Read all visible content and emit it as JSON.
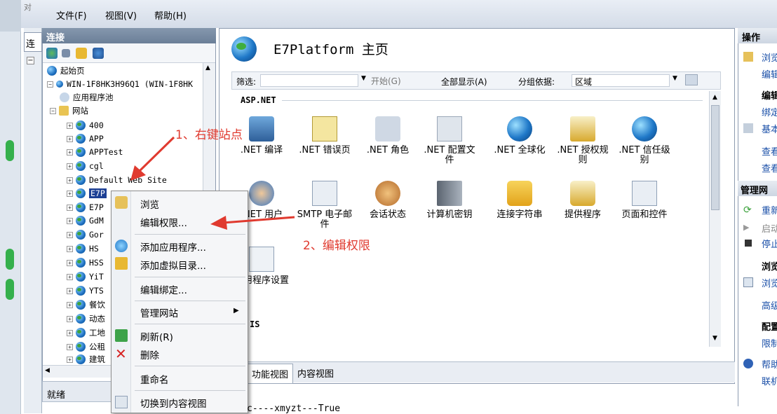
{
  "menu": {
    "file": "文件(F)",
    "view": "视图(V)",
    "help": "帮助(H)"
  },
  "left_strip": {
    "tab_text": "对",
    "conn_tab": "连"
  },
  "connections": {
    "header": "连接",
    "tree": [
      {
        "label": "起始页",
        "indent": 0
      },
      {
        "label": "WIN-1F8HK3H96Q1 (WIN-1F8HK",
        "indent": 0
      },
      {
        "label": "应用程序池",
        "indent": 1
      },
      {
        "label": "网站",
        "indent": 1
      },
      {
        "label": "400",
        "indent": 2
      },
      {
        "label": "APP",
        "indent": 2
      },
      {
        "label": "APPTest",
        "indent": 2
      },
      {
        "label": "cgl",
        "indent": 2
      },
      {
        "label": "Default Web Site",
        "indent": 2
      },
      {
        "label": "E7P",
        "indent": 2
      },
      {
        "label": "E7P",
        "indent": 2
      },
      {
        "label": "GdM",
        "indent": 2
      },
      {
        "label": "Gor",
        "indent": 2
      },
      {
        "label": "HS",
        "indent": 2
      },
      {
        "label": "HSS",
        "indent": 2
      },
      {
        "label": "YiT",
        "indent": 2
      },
      {
        "label": "YTS",
        "indent": 2
      },
      {
        "label": "餐饮",
        "indent": 2
      },
      {
        "label": "动态",
        "indent": 2
      },
      {
        "label": "工地",
        "indent": 2
      },
      {
        "label": "公租",
        "indent": 2
      },
      {
        "label": "建筑",
        "indent": 2
      }
    ],
    "status": "就绪"
  },
  "content": {
    "title": "E7Platform 主页",
    "filter_label": "筛选:",
    "start_label": "开始(G)",
    "show_all": "全部显示(A)",
    "group_by": "分组依据:",
    "group_value": "区域",
    "group_head": "ASP.NET",
    "group_head_2": "IS",
    "features_row1": [
      ".NET 编译",
      ".NET 错误页",
      ".NET 角色",
      ".NET 配置文件",
      ".NET 全球化",
      ".NET 授权规则",
      ".NET 信任级别"
    ],
    "features_row2": [
      ".NET 用户",
      "SMTP 电子邮件",
      "会话状态",
      "计算机密钥",
      "连接字符串",
      "提供程序",
      "页面和控件"
    ],
    "features_row3": [
      "应用程序设置"
    ],
    "bottom_tab_features": "功能视图",
    "bottom_tab_content": "内容视图"
  },
  "actions": {
    "header": "操作",
    "items": [
      "浏览",
      "编辑",
      "编辑",
      "绑定",
      "基本",
      "查看",
      "查看",
      "管理网",
      "重新",
      "启动",
      "停止",
      "浏览",
      "浏览",
      "高级",
      "配置",
      "限制",
      "帮助",
      "联机"
    ]
  },
  "context_menu": {
    "items": [
      "浏览",
      "编辑权限...",
      "添加应用程序...",
      "添加虚拟目录...",
      "编辑绑定...",
      "管理网站",
      "刷新(R)",
      "删除",
      "重命名",
      "切换到内容视图"
    ]
  },
  "annotations": {
    "step1": "1、右键站点",
    "step2": "2、编辑权限"
  },
  "below_text": "c----xmyzt---True",
  "colors": {
    "annotation_red": "#e03a2f",
    "accent_blue": "#1a4fa8"
  }
}
